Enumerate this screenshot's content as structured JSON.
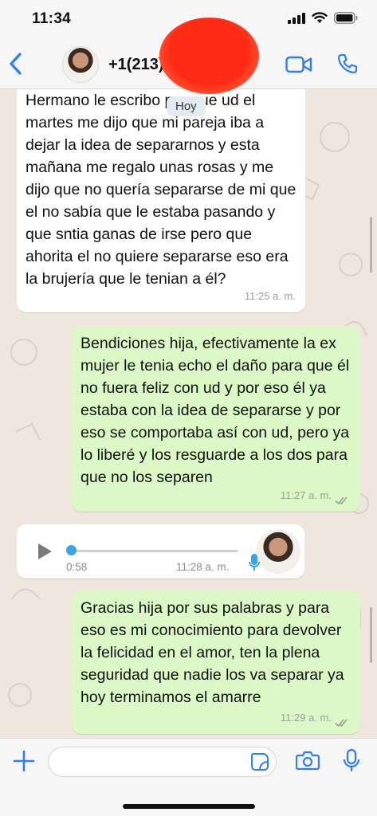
{
  "status_bar": {
    "time": "11:34"
  },
  "header": {
    "contact_name": "+1(213)"
  },
  "chat": {
    "date_chip": "Hoy",
    "messages": [
      {
        "direction": "in",
        "text": "Hermano le escribo por que ud el martes me dijo que mi pareja iba a dejar la idea de separarnos y esta mañana me regalo unas rosas y me dijo que no quería separarse de mi que el no sabía que le estaba pasando y que sntia ganas de irse pero que ahorita el no quiere separarse eso era la brujería que le tenian a él?",
        "time": "11:25 a. m."
      },
      {
        "direction": "out",
        "text": "Bendiciones hija, efectivamente la ex mujer le tenia echo el daño para que él no fuera feliz con ud y por eso él ya estaba con la idea de separarse y por eso se comportaba así con ud, pero ya lo liberé y los resguarde a los dos para que no los separen",
        "time": "11:27 a. m."
      },
      {
        "direction": "in",
        "type": "voice",
        "duration": "0:58",
        "time": "11:28 a. m.",
        "progress": 0
      },
      {
        "direction": "out",
        "text": "Gracias hija por sus palabras y para eso es mi conocimiento para devolver la felicidad en el amor, ten la plena seguridad que nadie los va separar ya hoy terminamos el amarre",
        "time": "11:29 a. m."
      }
    ]
  },
  "input_bar": {
    "message_value": "",
    "placeholder": ""
  },
  "colors": {
    "accent": "#2f7ff0",
    "incoming": "#ffffff",
    "outgoing": "#dcf8c6",
    "background": "#efe7de",
    "voice_progress": "#3aa4e5"
  }
}
